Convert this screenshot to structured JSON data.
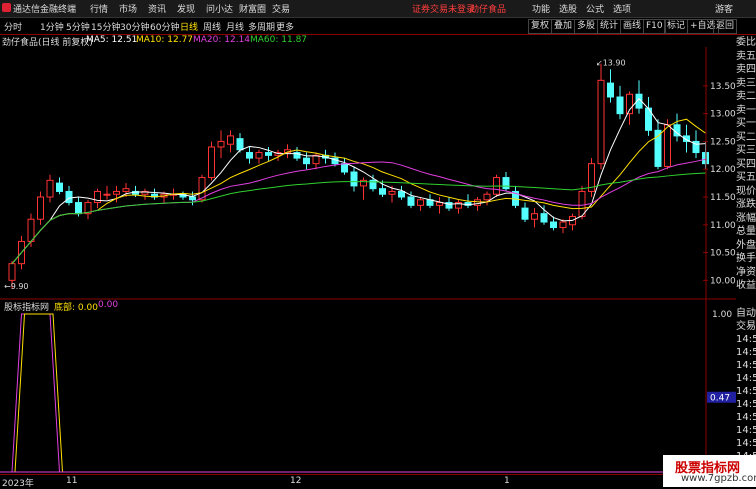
{
  "app": {
    "name": "通达信金融终端",
    "status_text": "证券交易未登录",
    "stock_link": "劲仔食品",
    "guest": "游客"
  },
  "menu": [
    "行情",
    "市场",
    "资讯",
    "发现",
    "问小达",
    "财富圈",
    "交易"
  ],
  "right_menu": [
    "功能",
    "选股",
    "公式",
    "选项"
  ],
  "period_tabs": [
    "分时",
    "1分钟",
    "5分钟",
    "15分钟",
    "30分钟",
    "60分钟",
    "日线",
    "周线",
    "月线",
    "多周期",
    "更多"
  ],
  "active_tab": "日线",
  "toolbar_buttons": [
    "复权",
    "叠加",
    "多股",
    "统计",
    "画线",
    "F10",
    "标记",
    "+自选",
    "返回"
  ],
  "info": {
    "name": "劲仔食品(日线 前复权)",
    "ma5": "MA5: 12.51",
    "ma10": "MA10: 12.77",
    "ma20": "MA20: 12.14",
    "ma60": "MA60: 11.87"
  },
  "colors": {
    "ma5": "#ffffff",
    "ma10": "#ffe000",
    "ma20": "#e040e0",
    "ma60": "#30d030",
    "up": "#ff3232",
    "down": "#54ffff"
  },
  "price_axis": [
    "13.50",
    "13.00",
    "12.50",
    "12.00",
    "11.50",
    "11.00",
    "10.50",
    "10.00"
  ],
  "price_annotations": {
    "high": "13.90",
    "low": "9.90"
  },
  "indicator": {
    "name": "股标指标网",
    "label": "底部: 0.00",
    "value2": "0.00",
    "axis_top": "1.00",
    "axis_bottom": "0.00",
    "current": "0.47"
  },
  "date_labels": [
    "2023年",
    "11",
    "12",
    "1"
  ],
  "side_labels": [
    "委比",
    "卖五",
    "卖四",
    "卖三",
    "卖二",
    "卖一",
    "买一",
    "买二",
    "买三",
    "买四",
    "买五",
    "现价",
    "涨跌",
    "涨幅",
    "总量",
    "外盘",
    "换手",
    "净资",
    "收益"
  ],
  "side_labels2": [
    "自动",
    "交易",
    "14:5",
    "14:5",
    "14:5",
    "14:5",
    "14:5",
    "14:5",
    "14:5",
    "14:5",
    "14:5",
    "14:5"
  ],
  "watermark": {
    "line1": "股票指标网",
    "line2": "www.7gpzb.com"
  },
  "chart_data": {
    "type": "candlestick",
    "ylim": [
      9.7,
      14.2
    ],
    "candles": [
      [
        10.0,
        10.35,
        9.85,
        10.3
      ],
      [
        10.3,
        10.8,
        10.2,
        10.7
      ],
      [
        10.7,
        11.2,
        10.6,
        11.1
      ],
      [
        11.1,
        11.6,
        11.0,
        11.5
      ],
      [
        11.5,
        11.9,
        11.4,
        11.8
      ],
      [
        11.75,
        11.85,
        11.55,
        11.6
      ],
      [
        11.6,
        11.7,
        11.35,
        11.4
      ],
      [
        11.4,
        11.5,
        11.15,
        11.2
      ],
      [
        11.2,
        11.45,
        11.1,
        11.4
      ],
      [
        11.4,
        11.65,
        11.3,
        11.6
      ],
      [
        11.55,
        11.7,
        11.45,
        11.55
      ],
      [
        11.55,
        11.7,
        11.4,
        11.6
      ],
      [
        11.6,
        11.75,
        11.5,
        11.65
      ],
      [
        11.6,
        11.7,
        11.5,
        11.55
      ],
      [
        11.55,
        11.65,
        11.45,
        11.6
      ],
      [
        11.55,
        11.65,
        11.45,
        11.5
      ],
      [
        11.5,
        11.6,
        11.4,
        11.55
      ],
      [
        11.55,
        11.65,
        11.45,
        11.55
      ],
      [
        11.55,
        11.6,
        11.45,
        11.5
      ],
      [
        11.5,
        11.6,
        11.35,
        11.45
      ],
      [
        11.45,
        11.9,
        11.4,
        11.85
      ],
      [
        11.85,
        12.5,
        11.8,
        12.4
      ],
      [
        12.4,
        12.7,
        12.2,
        12.5
      ],
      [
        12.45,
        12.7,
        12.3,
        12.6
      ],
      [
        12.55,
        12.65,
        12.3,
        12.35
      ],
      [
        12.3,
        12.4,
        12.1,
        12.2
      ],
      [
        12.2,
        12.35,
        12.1,
        12.3
      ],
      [
        12.3,
        12.4,
        12.15,
        12.25
      ],
      [
        12.25,
        12.35,
        12.15,
        12.3
      ],
      [
        12.3,
        12.45,
        12.2,
        12.35
      ],
      [
        12.3,
        12.4,
        12.15,
        12.2
      ],
      [
        12.2,
        12.3,
        12.0,
        12.1
      ],
      [
        12.1,
        12.3,
        12.0,
        12.25
      ],
      [
        12.25,
        12.35,
        12.1,
        12.2
      ],
      [
        12.2,
        12.3,
        12.05,
        12.1
      ],
      [
        12.1,
        12.2,
        11.9,
        11.95
      ],
      [
        11.95,
        12.05,
        11.6,
        11.7
      ],
      [
        11.7,
        11.85,
        11.45,
        11.8
      ],
      [
        11.8,
        11.9,
        11.6,
        11.65
      ],
      [
        11.65,
        11.8,
        11.5,
        11.55
      ],
      [
        11.55,
        11.7,
        11.4,
        11.6
      ],
      [
        11.6,
        11.7,
        11.45,
        11.5
      ],
      [
        11.5,
        11.6,
        11.3,
        11.35
      ],
      [
        11.35,
        11.5,
        11.25,
        11.45
      ],
      [
        11.45,
        11.55,
        11.3,
        11.35
      ],
      [
        11.35,
        11.5,
        11.2,
        11.4
      ],
      [
        11.4,
        11.5,
        11.25,
        11.3
      ],
      [
        11.3,
        11.45,
        11.2,
        11.4
      ],
      [
        11.4,
        11.55,
        11.3,
        11.35
      ],
      [
        11.35,
        11.5,
        11.25,
        11.45
      ],
      [
        11.45,
        11.6,
        11.35,
        11.55
      ],
      [
        11.55,
        11.9,
        11.5,
        11.85
      ],
      [
        11.85,
        11.95,
        11.6,
        11.65
      ],
      [
        11.6,
        11.7,
        11.3,
        11.35
      ],
      [
        11.3,
        11.4,
        11.05,
        11.1
      ],
      [
        11.1,
        11.3,
        10.95,
        11.2
      ],
      [
        11.2,
        11.35,
        11.0,
        11.05
      ],
      [
        11.05,
        11.15,
        10.9,
        10.95
      ],
      [
        10.95,
        11.1,
        10.85,
        11.05
      ],
      [
        11.0,
        11.2,
        10.9,
        11.15
      ],
      [
        11.15,
        11.7,
        11.1,
        11.6
      ],
      [
        11.6,
        12.2,
        11.5,
        12.1
      ],
      [
        12.1,
        13.9,
        12.0,
        13.6
      ],
      [
        13.55,
        13.8,
        13.2,
        13.3
      ],
      [
        13.3,
        13.5,
        12.9,
        13.0
      ],
      [
        13.0,
        13.4,
        12.8,
        13.35
      ],
      [
        13.35,
        13.6,
        13.0,
        13.1
      ],
      [
        13.1,
        13.3,
        12.6,
        12.7
      ],
      [
        12.7,
        12.9,
        12.0,
        12.05
      ],
      [
        12.05,
        12.9,
        12.0,
        12.8
      ],
      [
        12.8,
        13.0,
        12.5,
        12.6
      ],
      [
        12.6,
        12.8,
        12.3,
        12.5
      ],
      [
        12.5,
        12.7,
        12.2,
        12.3
      ],
      [
        12.3,
        12.5,
        12.0,
        12.1
      ]
    ],
    "indicator_values": [
      0,
      1,
      1,
      1,
      1,
      0,
      0,
      0,
      0,
      0,
      0,
      0,
      0,
      0,
      0,
      0,
      0,
      0,
      0,
      0,
      0,
      0,
      0,
      0,
      0,
      0,
      0,
      0,
      0,
      0,
      0,
      0,
      0,
      0,
      0,
      0,
      0,
      0,
      0,
      0,
      0,
      0,
      0,
      0,
      0,
      0,
      0,
      0,
      0,
      0,
      0,
      0,
      0,
      0,
      0,
      0,
      0,
      0,
      0,
      0,
      0,
      0,
      0,
      0,
      0,
      0,
      0,
      0,
      0,
      0,
      0,
      0,
      0,
      0
    ]
  }
}
